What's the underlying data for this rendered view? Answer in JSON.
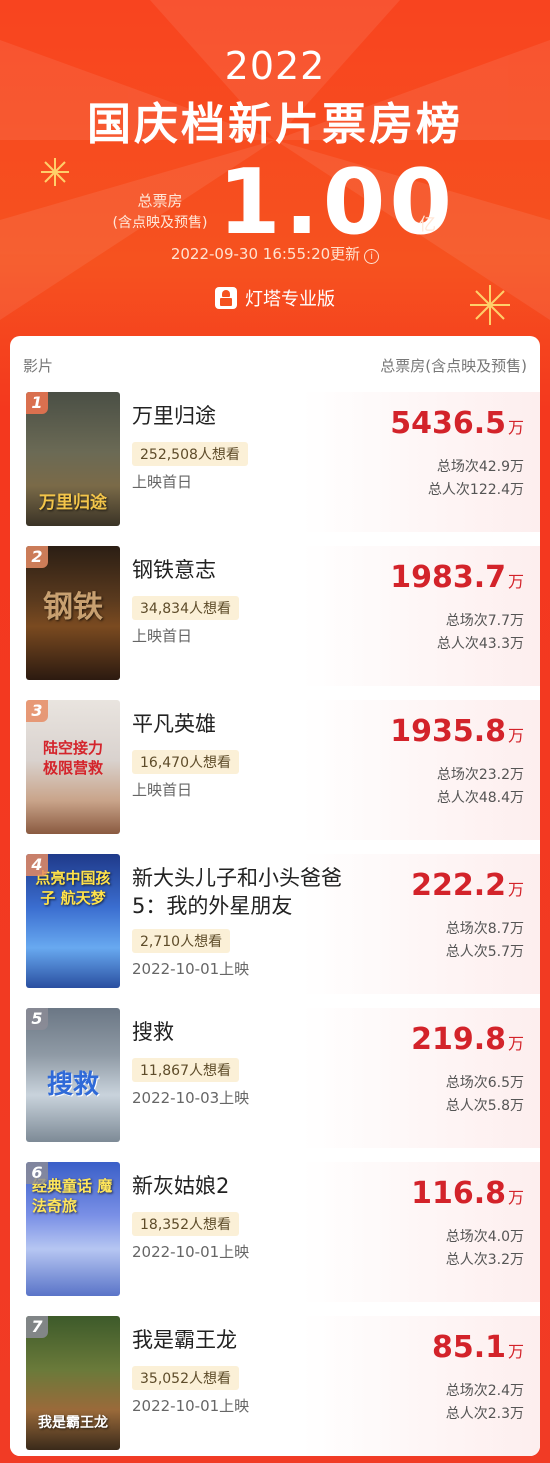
{
  "header": {
    "year": "2022",
    "title": "国庆档新片票房榜",
    "total_label": "总票房",
    "total_sublabel": "(含点映及预售)",
    "total_value": "1.00",
    "total_unit": "亿",
    "update_time": "2022-09-30 16:55:20更新",
    "info_glyph": "i",
    "brand": "灯塔专业版"
  },
  "columns": {
    "left": "影片",
    "right": "总票房(含点映及预售)"
  },
  "movies": [
    {
      "rank": "1",
      "name": "万里归途",
      "want": "252,508人想看",
      "release": "上映首日",
      "box": "5436.5",
      "unit": "万",
      "shows": "总场次42.9万",
      "audience": "总人次122.4万",
      "poster_text": "万里归途"
    },
    {
      "rank": "2",
      "name": "钢铁意志",
      "want": "34,834人想看",
      "release": "上映首日",
      "box": "1983.7",
      "unit": "万",
      "shows": "总场次7.7万",
      "audience": "总人次43.3万",
      "poster_text": "钢铁"
    },
    {
      "rank": "3",
      "name": "平凡英雄",
      "want": "16,470人想看",
      "release": "上映首日",
      "box": "1935.8",
      "unit": "万",
      "shows": "总场次23.2万",
      "audience": "总人次48.4万",
      "poster_text": "陆空接力 极限营救"
    },
    {
      "rank": "4",
      "name": "新大头儿子和小头爸爸5：我的外星朋友",
      "want": "2,710人想看",
      "release": "2022-10-01上映",
      "box": "222.2",
      "unit": "万",
      "shows": "总场次8.7万",
      "audience": "总人次5.7万",
      "poster_text": "点亮中国孩子 航天梦"
    },
    {
      "rank": "5",
      "name": "搜救",
      "want": "11,867人想看",
      "release": "2022-10-03上映",
      "box": "219.8",
      "unit": "万",
      "shows": "总场次6.5万",
      "audience": "总人次5.8万",
      "poster_text": "搜救"
    },
    {
      "rank": "6",
      "name": "新灰姑娘2",
      "want": "18,352人想看",
      "release": "2022-10-01上映",
      "box": "116.8",
      "unit": "万",
      "shows": "总场次4.0万",
      "audience": "总人次3.2万",
      "poster_text": "经典童话 魔法奇旅"
    },
    {
      "rank": "7",
      "name": "我是霸王龙",
      "want": "35,052人想看",
      "release": "2022-10-01上映",
      "box": "85.1",
      "unit": "万",
      "shows": "总场次2.4万",
      "audience": "总人次2.3万",
      "poster_text": "我是霸王龙"
    }
  ],
  "colors": {
    "background": "#f4381e",
    "box_value": "#d3232a",
    "want_badge_bg": "#fbf0d7"
  }
}
